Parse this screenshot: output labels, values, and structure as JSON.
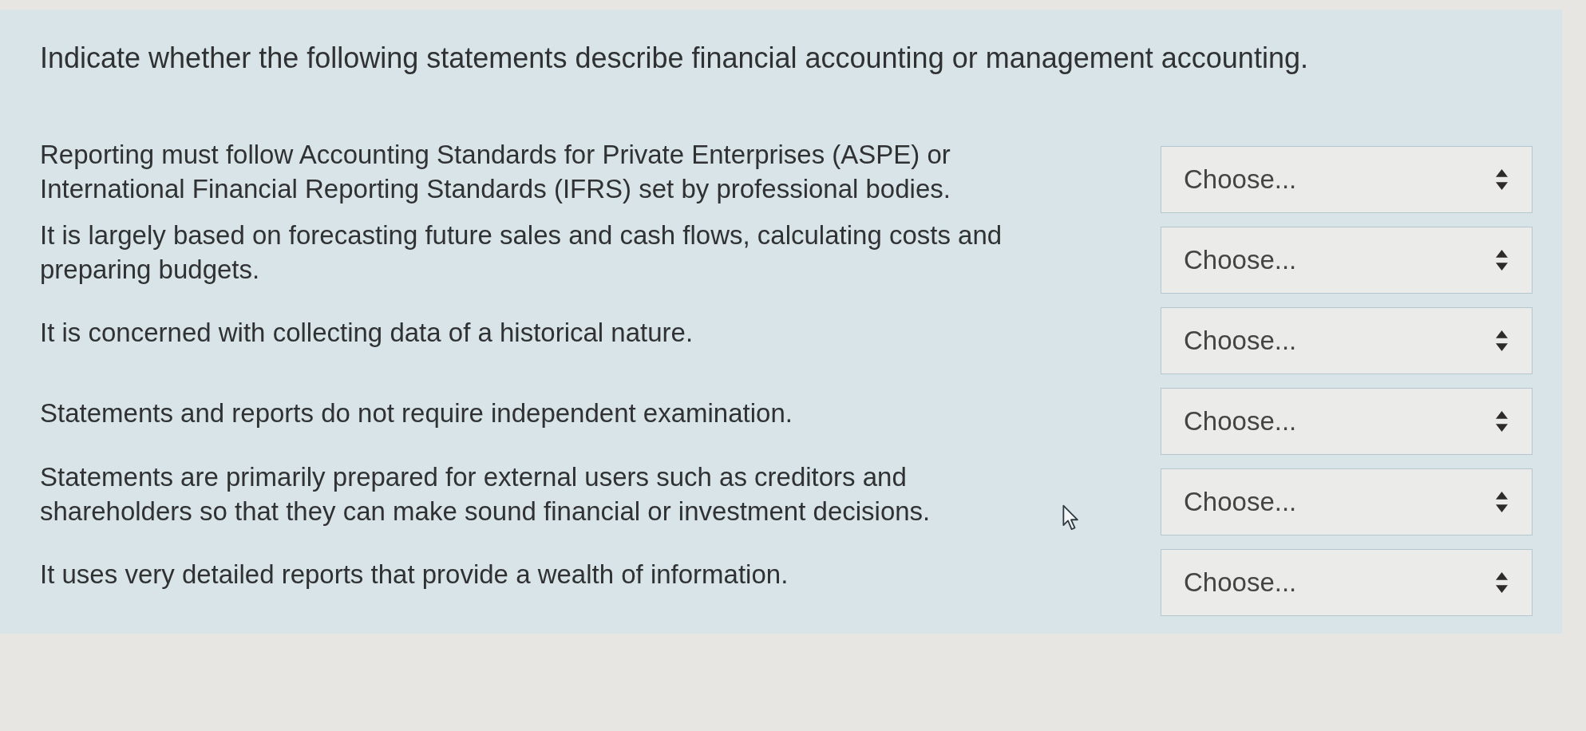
{
  "instruction": "Indicate whether the following statements describe financial accounting or management accounting.",
  "statements": [
    {
      "text": "Reporting must follow Accounting Standards for Private Enterprises (ASPE) or International Financial Reporting Standards (IFRS) set by professional bodies.",
      "dropdown": {
        "value": "Choose..."
      }
    },
    {
      "text": "It is largely based on forecasting future sales and cash flows, calculating costs and preparing budgets.",
      "dropdown": {
        "value": "Choose..."
      }
    },
    {
      "text": "It is concerned with collecting data of a historical nature.",
      "dropdown": {
        "value": "Choose..."
      }
    },
    {
      "text": "Statements and reports do not require independent examination.",
      "dropdown": {
        "value": "Choose..."
      }
    },
    {
      "text": "Statements are primarily prepared for external users such as creditors and shareholders so that they can make sound financial or investment decisions.",
      "dropdown": {
        "value": "Choose..."
      }
    },
    {
      "text": "It uses very detailed reports that provide a wealth of information.",
      "dropdown": {
        "value": "Choose..."
      }
    }
  ]
}
